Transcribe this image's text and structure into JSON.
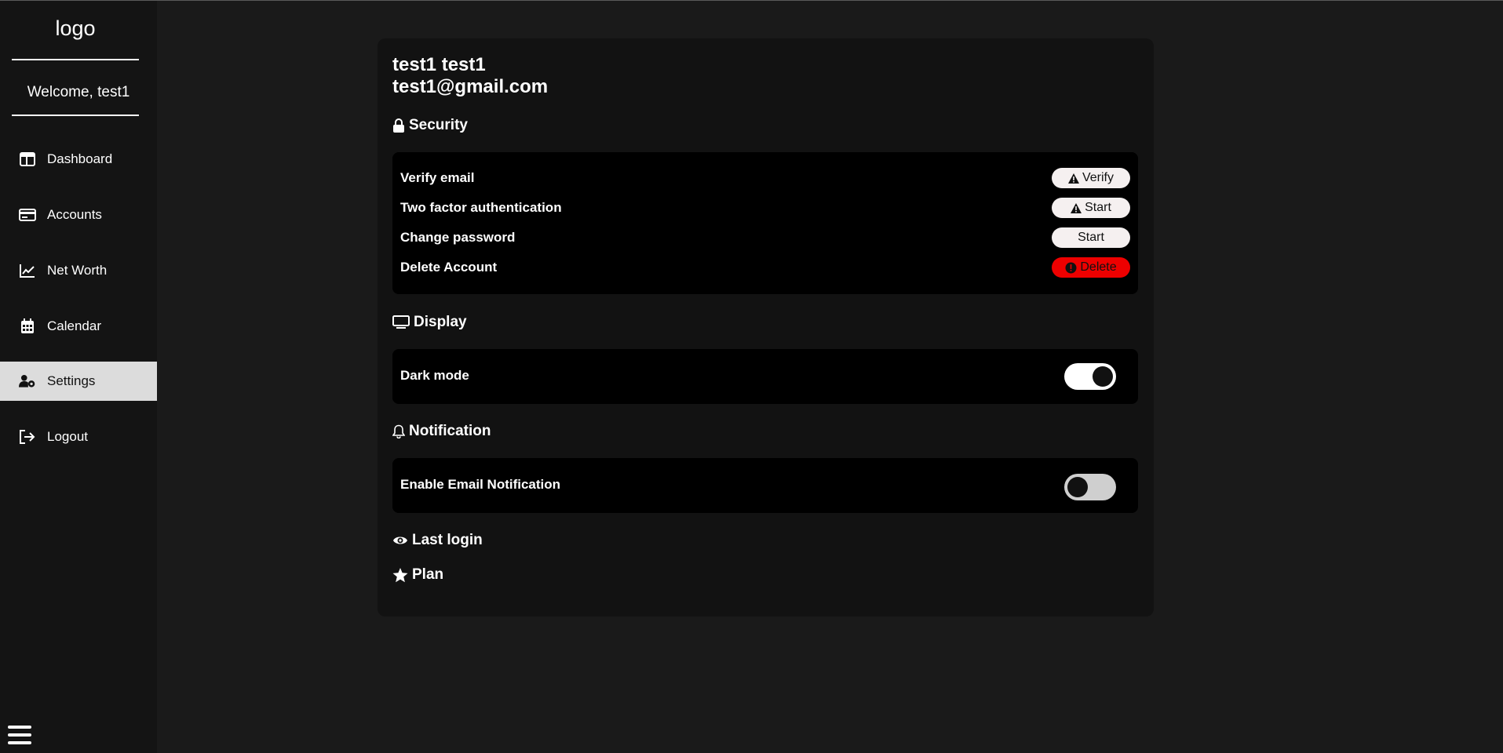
{
  "sidebar": {
    "logo": "logo",
    "welcome": "Welcome, test1",
    "items": [
      {
        "label": "Dashboard",
        "icon": "dashboard-icon"
      },
      {
        "label": "Accounts",
        "icon": "card-icon"
      },
      {
        "label": "Net Worth",
        "icon": "chart-line-icon"
      },
      {
        "label": "Calendar",
        "icon": "calendar-icon"
      },
      {
        "label": "Settings",
        "icon": "user-gear-icon",
        "active": true
      },
      {
        "label": "Logout",
        "icon": "logout-icon"
      }
    ],
    "menu_icon": "hamburger-icon"
  },
  "profile": {
    "name": "test1 test1",
    "email": "test1@gmail.com"
  },
  "security": {
    "title": "Security",
    "rows": [
      {
        "label": "Verify email",
        "button": "Verify",
        "icon": "warning-icon"
      },
      {
        "label": "Two factor authentication",
        "button": "Start",
        "icon": "warning-icon"
      },
      {
        "label": "Change password",
        "button": "Start"
      },
      {
        "label": "Delete Account",
        "button": "Delete",
        "icon": "alert-circle-icon"
      }
    ]
  },
  "display": {
    "title": "Display",
    "dark_mode_label": "Dark mode",
    "dark_mode_on": true
  },
  "notification": {
    "title": "Notification",
    "email_label": "Enable Email Notification",
    "email_on": false
  },
  "last_login": {
    "title": "Last login"
  },
  "plan": {
    "title": "Plan"
  },
  "colors": {
    "background": "#1a1a1a",
    "card": "#121212",
    "panel": "#000000",
    "danger": "#ee0000",
    "active_nav": "#dcdcdc"
  }
}
